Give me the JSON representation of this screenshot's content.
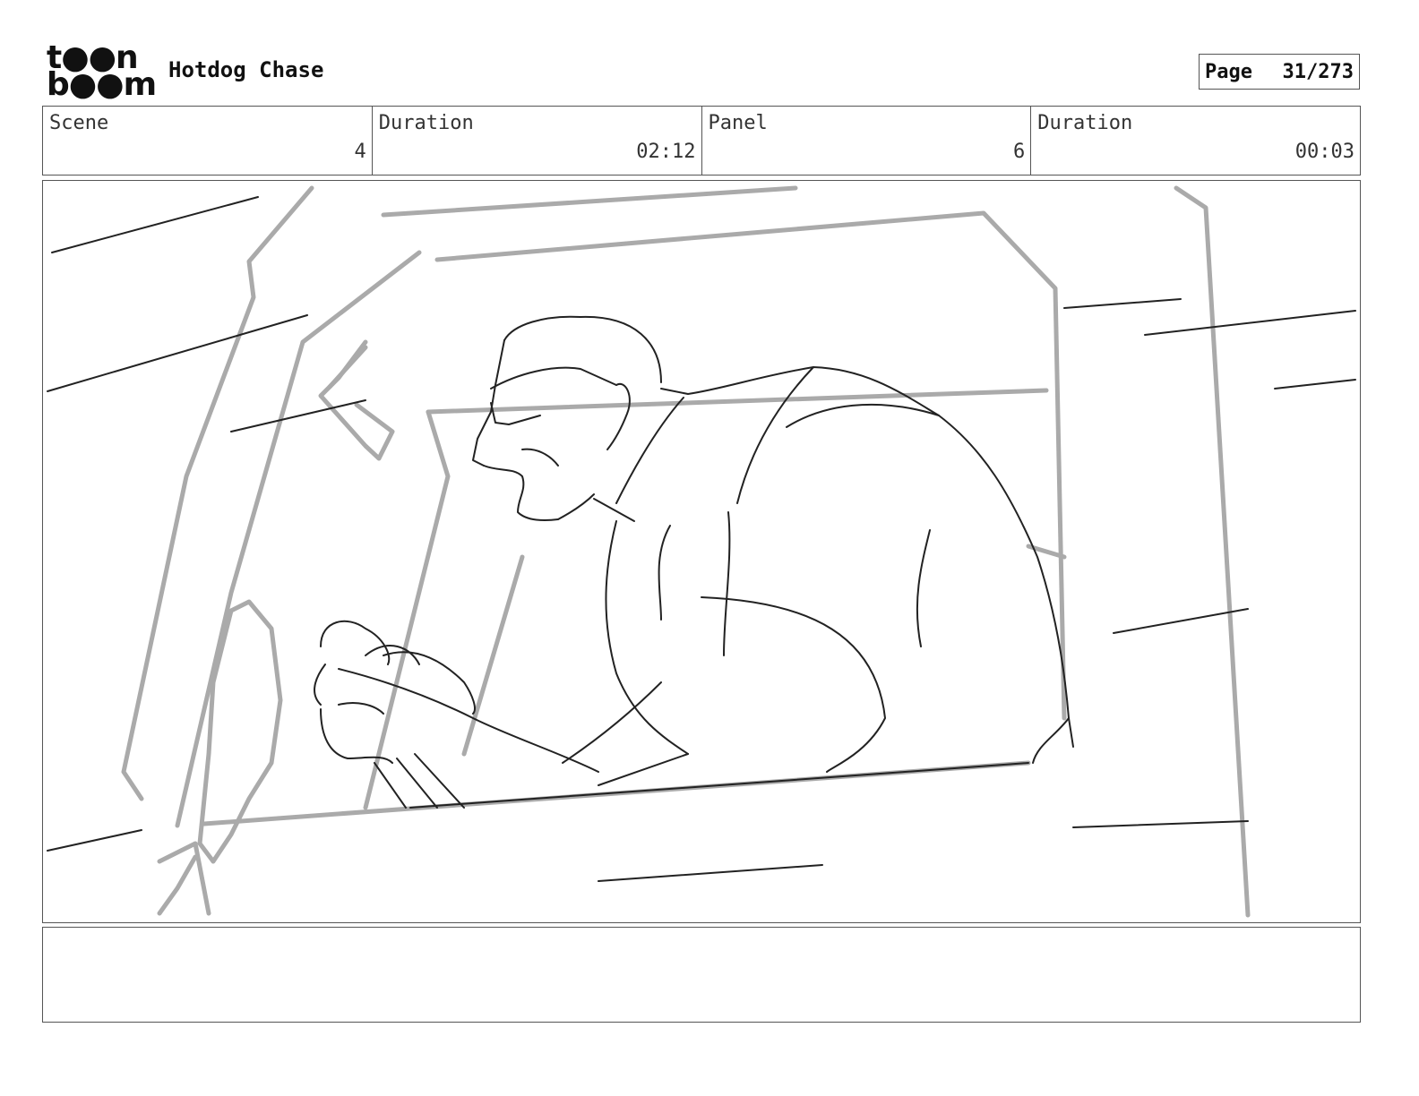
{
  "logo": {
    "line1": "t●●n",
    "line2": "b●●m"
  },
  "project": {
    "title": "Hotdog Chase"
  },
  "page": {
    "label": "Page",
    "number": "31/273"
  },
  "info": [
    {
      "label": "Scene",
      "value": "4"
    },
    {
      "label": "Duration",
      "value": "02:12"
    },
    {
      "label": "Panel",
      "value": "6"
    },
    {
      "label": "Duration",
      "value": "00:03"
    }
  ],
  "panel_image": {
    "icon": "storyboard-sketch-driver-truck-cab"
  },
  "notes": {
    "text": ""
  }
}
